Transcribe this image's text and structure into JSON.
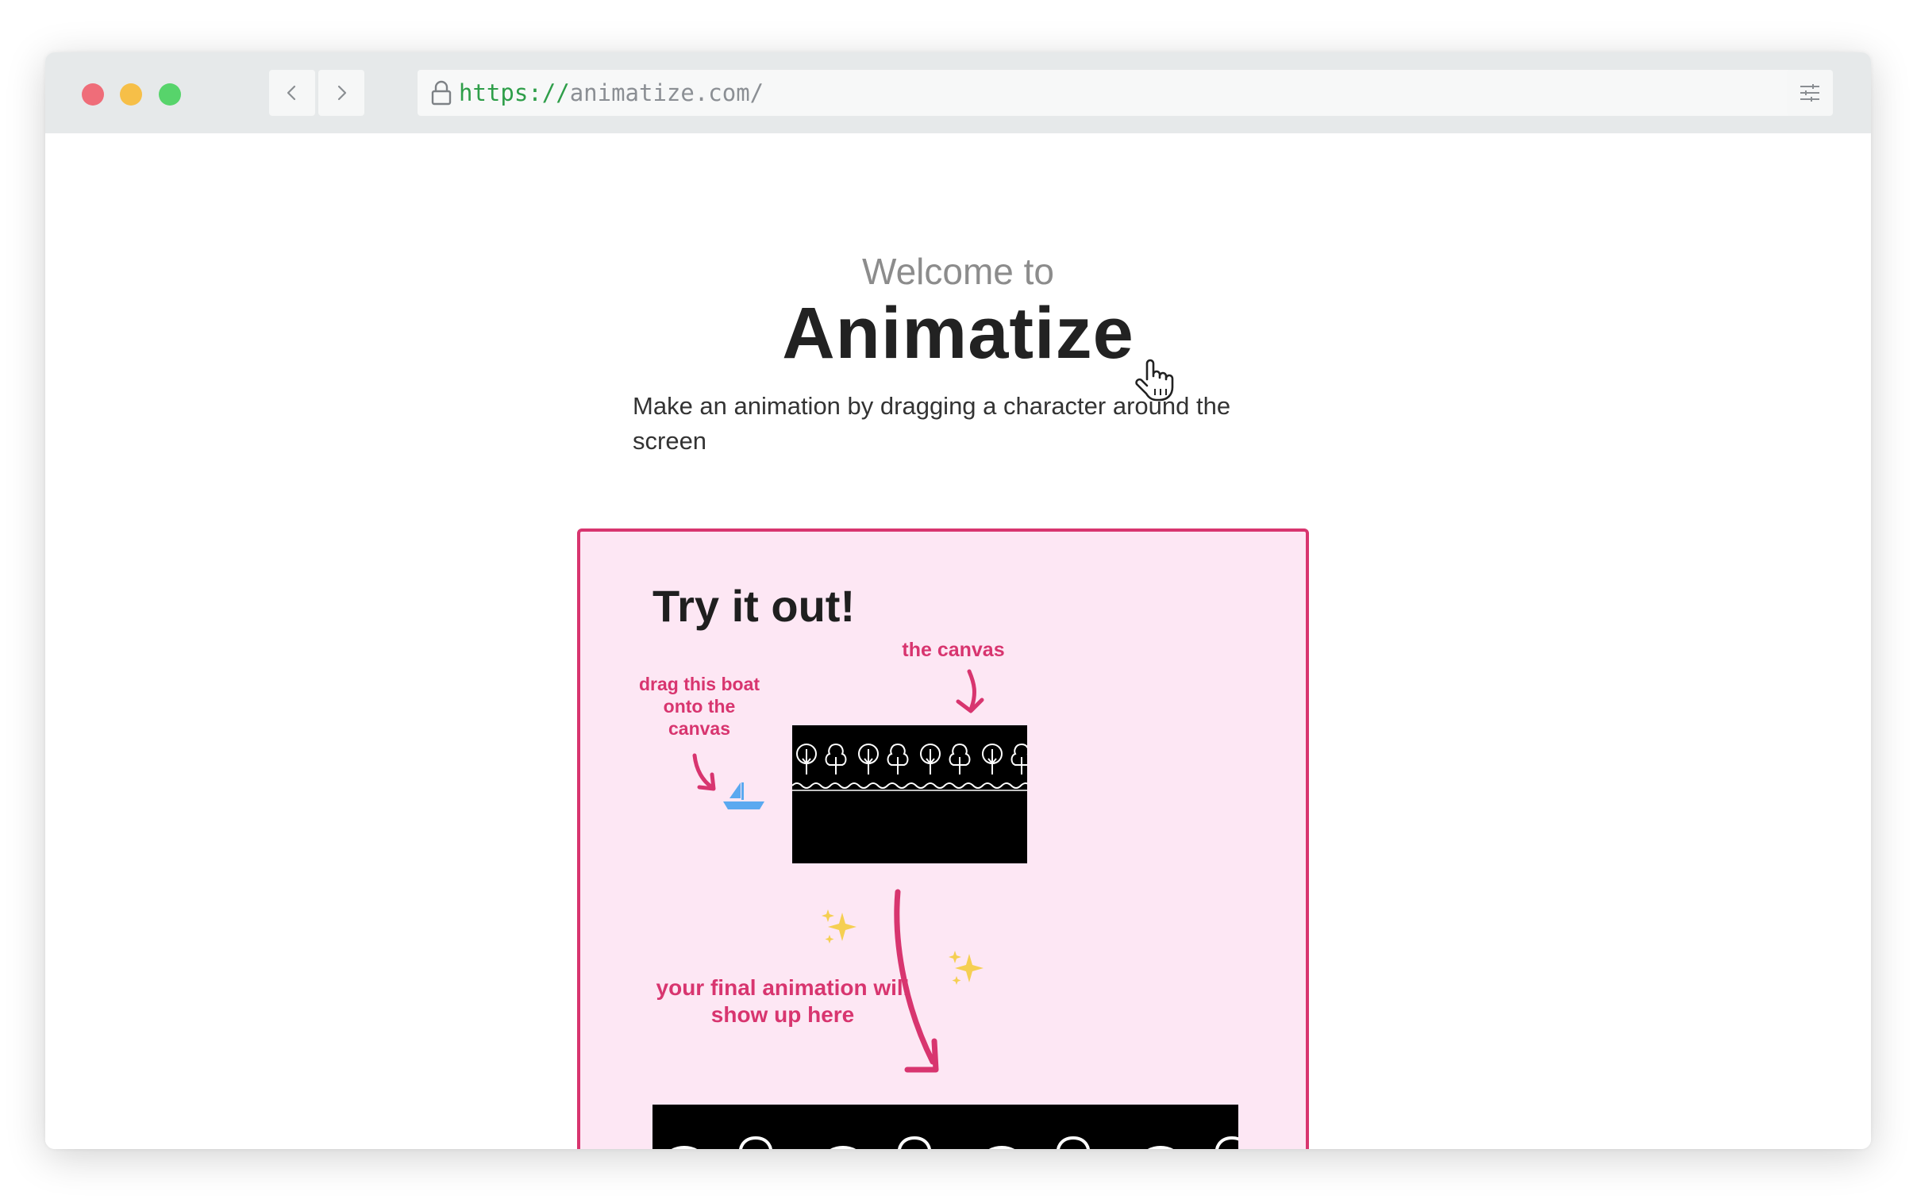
{
  "browser": {
    "url_scheme": "https://",
    "url_host": "animatize.com/",
    "icons": {
      "back": "chevron-left-icon",
      "forward": "chevron-right-icon",
      "lock": "lock-icon",
      "menu": "sliders-icon"
    },
    "traffic_lights": {
      "red": "#ef6d79",
      "yellow": "#f6bf48",
      "green": "#57d46b"
    }
  },
  "hero": {
    "welcome": "Welcome to",
    "brand": "Animatize",
    "tagline": "Make an animation by dragging a character around the screen"
  },
  "demo": {
    "heading": "Try it out!",
    "canvas_label": "the canvas",
    "drag_label": "drag this boat onto the canvas",
    "final_label": "your final animation will show up here"
  },
  "colors": {
    "accent": "#d8356f",
    "panel_bg": "#fde7f4",
    "boat": "#5aa9f0",
    "sparkle": "#f5cf52"
  }
}
